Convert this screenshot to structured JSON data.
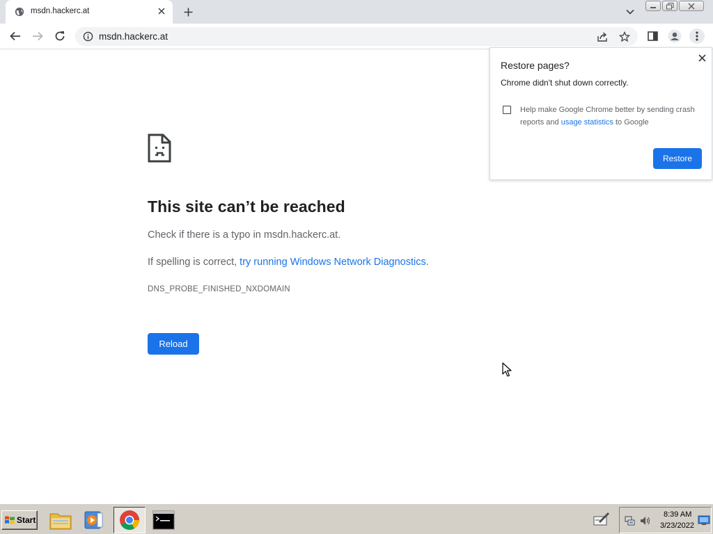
{
  "browser": {
    "tab": {
      "title": "msdn.hackerc.at",
      "favicon": "globe-icon"
    },
    "toolbar": {
      "url": "msdn.hackerc.at"
    }
  },
  "error_page": {
    "title": "This site can’t be reached",
    "line1": "Check if there is a typo in msdn.hackerc.at.",
    "line2_prefix": "If spelling is correct, ",
    "line2_link": "try running Windows Network Diagnostics",
    "line2_suffix": ".",
    "error_code": "DNS_PROBE_FINISHED_NXDOMAIN",
    "reload_label": "Reload"
  },
  "restore_bubble": {
    "title": "Restore pages?",
    "message": "Chrome didn't shut down correctly.",
    "help_prefix": "Help make Google Chrome better by sending crash reports and ",
    "help_link": "usage statistics",
    "help_suffix": " to Google",
    "restore_label": "Restore",
    "checkbox_checked": false
  },
  "taskbar": {
    "start_label": "Start",
    "apps": [
      "file-explorer-icon",
      "media-player-icon",
      "chrome-icon",
      "command-prompt-icon"
    ],
    "active_app": "chrome-icon",
    "clock_time": "8:39 AM",
    "clock_date": "3/23/2022"
  },
  "colors": {
    "accent": "#1a73e8",
    "tabstrip": "#dee1e6",
    "taskbar": "#d4d0c8",
    "text_secondary": "#5f6368"
  }
}
